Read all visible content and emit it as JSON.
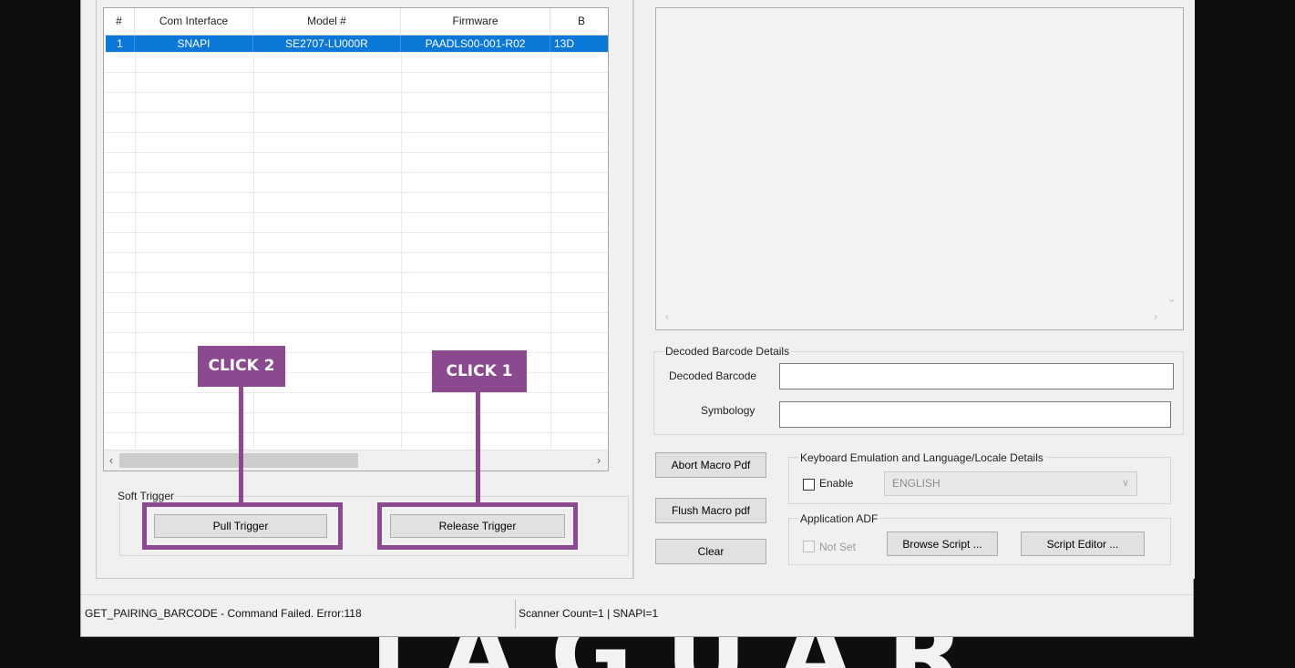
{
  "backdrop": {
    "text": "JAGUAR"
  },
  "scanner_table": {
    "columns": [
      "#",
      "Com Interface",
      "Model #",
      "Firmware",
      "B"
    ],
    "rows": [
      {
        "index": "1",
        "com_interface": "SNAPI",
        "model": "SE2707-LU000R",
        "firmware": "PAADLS00-001-R02",
        "b": "13D"
      }
    ]
  },
  "soft_trigger": {
    "title": "Soft Trigger",
    "pull_label": "Pull Trigger",
    "release_label": "Release Trigger"
  },
  "callouts": {
    "first": "CLICK 1",
    "second": "CLICK 2"
  },
  "decoded_details": {
    "title": "Decoded Barcode Details",
    "barcode_label": "Decoded Barcode",
    "barcode_value": "",
    "symbology_label": "Symbology",
    "symbology_value": ""
  },
  "macro_buttons": {
    "abort": "Abort Macro Pdf",
    "flush": "Flush Macro  pdf",
    "clear": "Clear"
  },
  "keyboard_emulation": {
    "title": "Keyboard Emulation and Language/Locale Details",
    "enable_label": "Enable",
    "enable_checked": false,
    "language": "ENGLISH"
  },
  "application_adf": {
    "title": "Application ADF",
    "not_set_label": "Not Set",
    "browse_label": "Browse Script ...",
    "editor_label": "Script Editor ..."
  },
  "status_bar": {
    "message": "GET_PAIRING_BARCODE - Command Failed. Error:118",
    "counts": "Scanner Count=1  |  SNAPI=1"
  },
  "colors": {
    "selection": "#0b78d7",
    "callout": "#8b4a8f",
    "window_bg": "#f0f0f0"
  }
}
